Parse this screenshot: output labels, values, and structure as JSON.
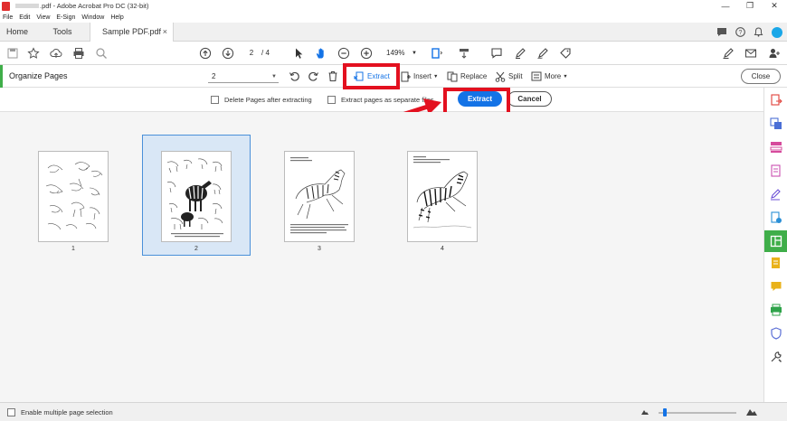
{
  "titlebar": {
    "title": ".pdf - Adobe Acrobat Pro DC (32-bit)",
    "minimize": "—",
    "restore": "❐",
    "close": "✕"
  },
  "menubar": {
    "items": [
      "File",
      "Edit",
      "View",
      "E-Sign",
      "Window",
      "Help"
    ]
  },
  "tabs": {
    "home": "Home",
    "tools": "Tools",
    "document": "Sample PDF.pdf",
    "document_close": "×"
  },
  "toolbar": {
    "current_page": "2",
    "page_total": "/ 4",
    "zoom": "149%"
  },
  "organize": {
    "title": "Organize Pages",
    "page_range": "2",
    "extract": "Extract",
    "insert": "Insert",
    "replace": "Replace",
    "split": "Split",
    "more": "More",
    "close": "Close"
  },
  "extract_options": {
    "delete_pages": "Delete Pages after extracting",
    "separate_files": "Extract pages as separate files",
    "extract_button": "Extract",
    "cancel_button": "Cancel"
  },
  "pages": [
    {
      "number": "1",
      "selected": false
    },
    {
      "number": "2",
      "selected": true
    },
    {
      "number": "3",
      "selected": false
    },
    {
      "number": "4",
      "selected": false
    }
  ],
  "bottom": {
    "multi_select": "Enable multiple page selection"
  },
  "colors": {
    "accent_blue": "#1473e6",
    "highlight_red": "#e3101f",
    "tool_green": "#3fae49",
    "selection_bg": "#d9e7f6"
  }
}
